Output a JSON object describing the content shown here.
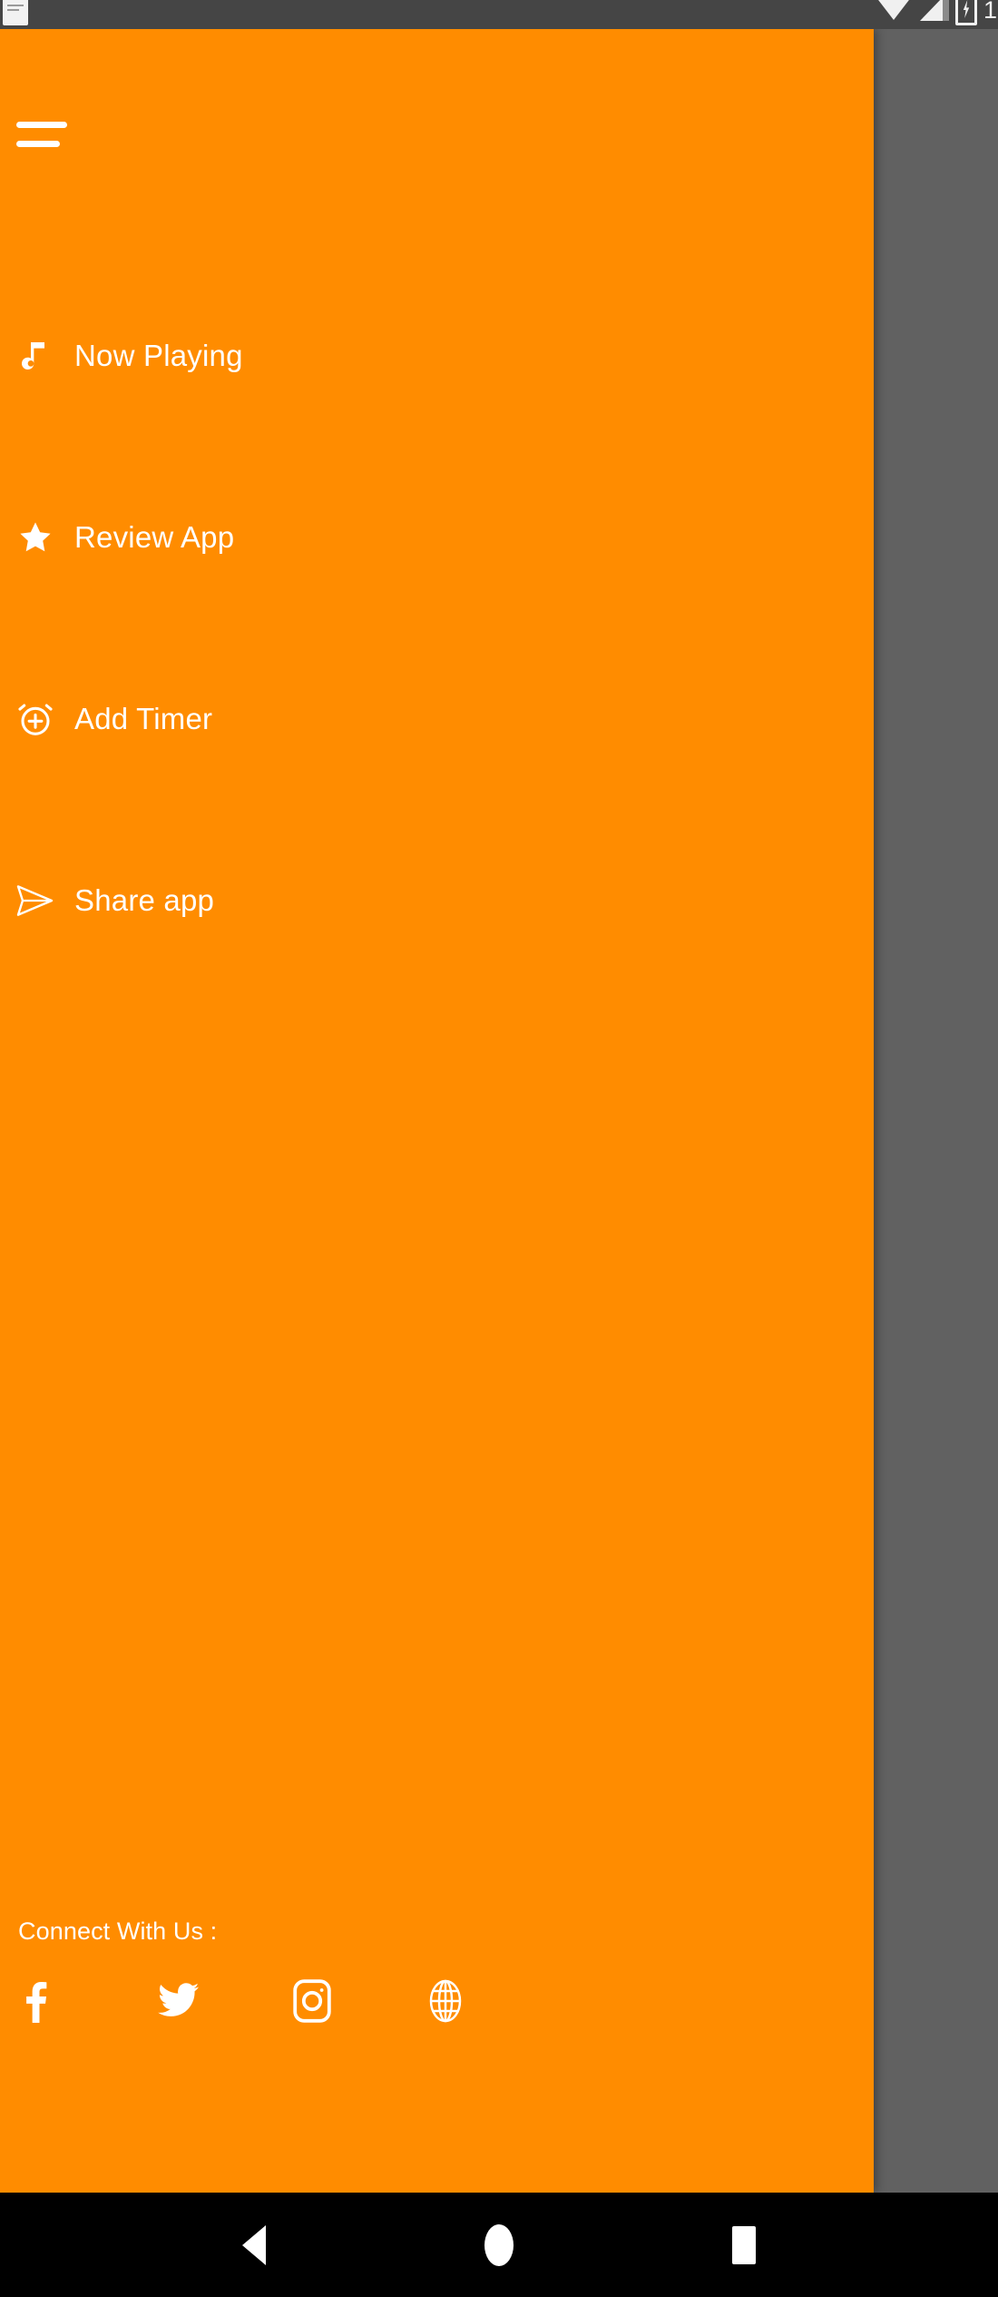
{
  "status_bar": {
    "time": "1",
    "icons": [
      "notification-icon",
      "wifi-icon",
      "signal-icon",
      "battery-charging-icon"
    ]
  },
  "drawer": {
    "menu_button": "menu-icon",
    "items": [
      {
        "label": "Now Playing",
        "icon": "music-note-icon"
      },
      {
        "label": "Review App",
        "icon": "star-icon"
      },
      {
        "label": "Add Timer",
        "icon": "alarm-add-icon"
      },
      {
        "label": "Share app",
        "icon": "send-icon"
      }
    ],
    "connect": {
      "title": "Connect With Us :",
      "socials": [
        {
          "name": "facebook",
          "icon": "facebook-icon"
        },
        {
          "name": "twitter",
          "icon": "twitter-icon"
        },
        {
          "name": "instagram",
          "icon": "instagram-icon"
        },
        {
          "name": "website",
          "icon": "globe-icon"
        }
      ]
    },
    "background_color": "#FF8C00"
  },
  "scrim": {
    "color": "#616161"
  },
  "navbar": {
    "buttons": [
      {
        "name": "back",
        "icon": "back-triangle-icon"
      },
      {
        "name": "home",
        "icon": "home-circle-icon"
      },
      {
        "name": "recents",
        "icon": "recents-square-icon"
      }
    ],
    "background_color": "#000000"
  }
}
